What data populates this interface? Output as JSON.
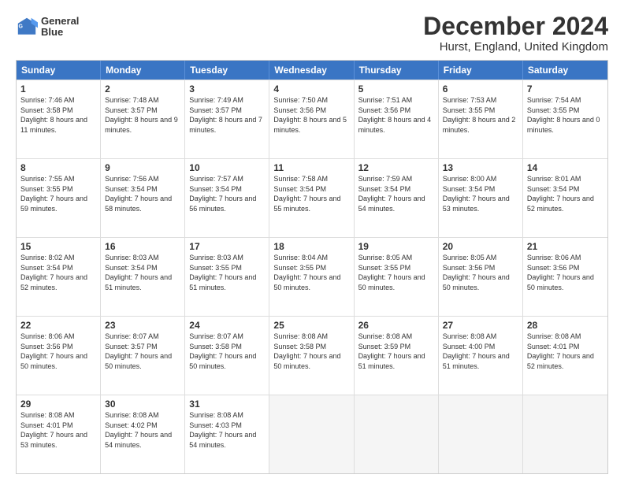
{
  "header": {
    "logo_line1": "General",
    "logo_line2": "Blue",
    "main_title": "December 2024",
    "subtitle": "Hurst, England, United Kingdom"
  },
  "calendar": {
    "days_of_week": [
      "Sunday",
      "Monday",
      "Tuesday",
      "Wednesday",
      "Thursday",
      "Friday",
      "Saturday"
    ],
    "weeks": [
      [
        {
          "day": "1",
          "sunrise": "Sunrise: 7:46 AM",
          "sunset": "Sunset: 3:58 PM",
          "daylight": "Daylight: 8 hours and 11 minutes.",
          "empty": false
        },
        {
          "day": "2",
          "sunrise": "Sunrise: 7:48 AM",
          "sunset": "Sunset: 3:57 PM",
          "daylight": "Daylight: 8 hours and 9 minutes.",
          "empty": false
        },
        {
          "day": "3",
          "sunrise": "Sunrise: 7:49 AM",
          "sunset": "Sunset: 3:57 PM",
          "daylight": "Daylight: 8 hours and 7 minutes.",
          "empty": false
        },
        {
          "day": "4",
          "sunrise": "Sunrise: 7:50 AM",
          "sunset": "Sunset: 3:56 PM",
          "daylight": "Daylight: 8 hours and 5 minutes.",
          "empty": false
        },
        {
          "day": "5",
          "sunrise": "Sunrise: 7:51 AM",
          "sunset": "Sunset: 3:56 PM",
          "daylight": "Daylight: 8 hours and 4 minutes.",
          "empty": false
        },
        {
          "day": "6",
          "sunrise": "Sunrise: 7:53 AM",
          "sunset": "Sunset: 3:55 PM",
          "daylight": "Daylight: 8 hours and 2 minutes.",
          "empty": false
        },
        {
          "day": "7",
          "sunrise": "Sunrise: 7:54 AM",
          "sunset": "Sunset: 3:55 PM",
          "daylight": "Daylight: 8 hours and 0 minutes.",
          "empty": false
        }
      ],
      [
        {
          "day": "8",
          "sunrise": "Sunrise: 7:55 AM",
          "sunset": "Sunset: 3:55 PM",
          "daylight": "Daylight: 7 hours and 59 minutes.",
          "empty": false
        },
        {
          "day": "9",
          "sunrise": "Sunrise: 7:56 AM",
          "sunset": "Sunset: 3:54 PM",
          "daylight": "Daylight: 7 hours and 58 minutes.",
          "empty": false
        },
        {
          "day": "10",
          "sunrise": "Sunrise: 7:57 AM",
          "sunset": "Sunset: 3:54 PM",
          "daylight": "Daylight: 7 hours and 56 minutes.",
          "empty": false
        },
        {
          "day": "11",
          "sunrise": "Sunrise: 7:58 AM",
          "sunset": "Sunset: 3:54 PM",
          "daylight": "Daylight: 7 hours and 55 minutes.",
          "empty": false
        },
        {
          "day": "12",
          "sunrise": "Sunrise: 7:59 AM",
          "sunset": "Sunset: 3:54 PM",
          "daylight": "Daylight: 7 hours and 54 minutes.",
          "empty": false
        },
        {
          "day": "13",
          "sunrise": "Sunrise: 8:00 AM",
          "sunset": "Sunset: 3:54 PM",
          "daylight": "Daylight: 7 hours and 53 minutes.",
          "empty": false
        },
        {
          "day": "14",
          "sunrise": "Sunrise: 8:01 AM",
          "sunset": "Sunset: 3:54 PM",
          "daylight": "Daylight: 7 hours and 52 minutes.",
          "empty": false
        }
      ],
      [
        {
          "day": "15",
          "sunrise": "Sunrise: 8:02 AM",
          "sunset": "Sunset: 3:54 PM",
          "daylight": "Daylight: 7 hours and 52 minutes.",
          "empty": false
        },
        {
          "day": "16",
          "sunrise": "Sunrise: 8:03 AM",
          "sunset": "Sunset: 3:54 PM",
          "daylight": "Daylight: 7 hours and 51 minutes.",
          "empty": false
        },
        {
          "day": "17",
          "sunrise": "Sunrise: 8:03 AM",
          "sunset": "Sunset: 3:55 PM",
          "daylight": "Daylight: 7 hours and 51 minutes.",
          "empty": false
        },
        {
          "day": "18",
          "sunrise": "Sunrise: 8:04 AM",
          "sunset": "Sunset: 3:55 PM",
          "daylight": "Daylight: 7 hours and 50 minutes.",
          "empty": false
        },
        {
          "day": "19",
          "sunrise": "Sunrise: 8:05 AM",
          "sunset": "Sunset: 3:55 PM",
          "daylight": "Daylight: 7 hours and 50 minutes.",
          "empty": false
        },
        {
          "day": "20",
          "sunrise": "Sunrise: 8:05 AM",
          "sunset": "Sunset: 3:56 PM",
          "daylight": "Daylight: 7 hours and 50 minutes.",
          "empty": false
        },
        {
          "day": "21",
          "sunrise": "Sunrise: 8:06 AM",
          "sunset": "Sunset: 3:56 PM",
          "daylight": "Daylight: 7 hours and 50 minutes.",
          "empty": false
        }
      ],
      [
        {
          "day": "22",
          "sunrise": "Sunrise: 8:06 AM",
          "sunset": "Sunset: 3:56 PM",
          "daylight": "Daylight: 7 hours and 50 minutes.",
          "empty": false
        },
        {
          "day": "23",
          "sunrise": "Sunrise: 8:07 AM",
          "sunset": "Sunset: 3:57 PM",
          "daylight": "Daylight: 7 hours and 50 minutes.",
          "empty": false
        },
        {
          "day": "24",
          "sunrise": "Sunrise: 8:07 AM",
          "sunset": "Sunset: 3:58 PM",
          "daylight": "Daylight: 7 hours and 50 minutes.",
          "empty": false
        },
        {
          "day": "25",
          "sunrise": "Sunrise: 8:08 AM",
          "sunset": "Sunset: 3:58 PM",
          "daylight": "Daylight: 7 hours and 50 minutes.",
          "empty": false
        },
        {
          "day": "26",
          "sunrise": "Sunrise: 8:08 AM",
          "sunset": "Sunset: 3:59 PM",
          "daylight": "Daylight: 7 hours and 51 minutes.",
          "empty": false
        },
        {
          "day": "27",
          "sunrise": "Sunrise: 8:08 AM",
          "sunset": "Sunset: 4:00 PM",
          "daylight": "Daylight: 7 hours and 51 minutes.",
          "empty": false
        },
        {
          "day": "28",
          "sunrise": "Sunrise: 8:08 AM",
          "sunset": "Sunset: 4:01 PM",
          "daylight": "Daylight: 7 hours and 52 minutes.",
          "empty": false
        }
      ],
      [
        {
          "day": "29",
          "sunrise": "Sunrise: 8:08 AM",
          "sunset": "Sunset: 4:01 PM",
          "daylight": "Daylight: 7 hours and 53 minutes.",
          "empty": false
        },
        {
          "day": "30",
          "sunrise": "Sunrise: 8:08 AM",
          "sunset": "Sunset: 4:02 PM",
          "daylight": "Daylight: 7 hours and 54 minutes.",
          "empty": false
        },
        {
          "day": "31",
          "sunrise": "Sunrise: 8:08 AM",
          "sunset": "Sunset: 4:03 PM",
          "daylight": "Daylight: 7 hours and 54 minutes.",
          "empty": false
        },
        {
          "day": "",
          "sunrise": "",
          "sunset": "",
          "daylight": "",
          "empty": true
        },
        {
          "day": "",
          "sunrise": "",
          "sunset": "",
          "daylight": "",
          "empty": true
        },
        {
          "day": "",
          "sunrise": "",
          "sunset": "",
          "daylight": "",
          "empty": true
        },
        {
          "day": "",
          "sunrise": "",
          "sunset": "",
          "daylight": "",
          "empty": true
        }
      ]
    ]
  }
}
